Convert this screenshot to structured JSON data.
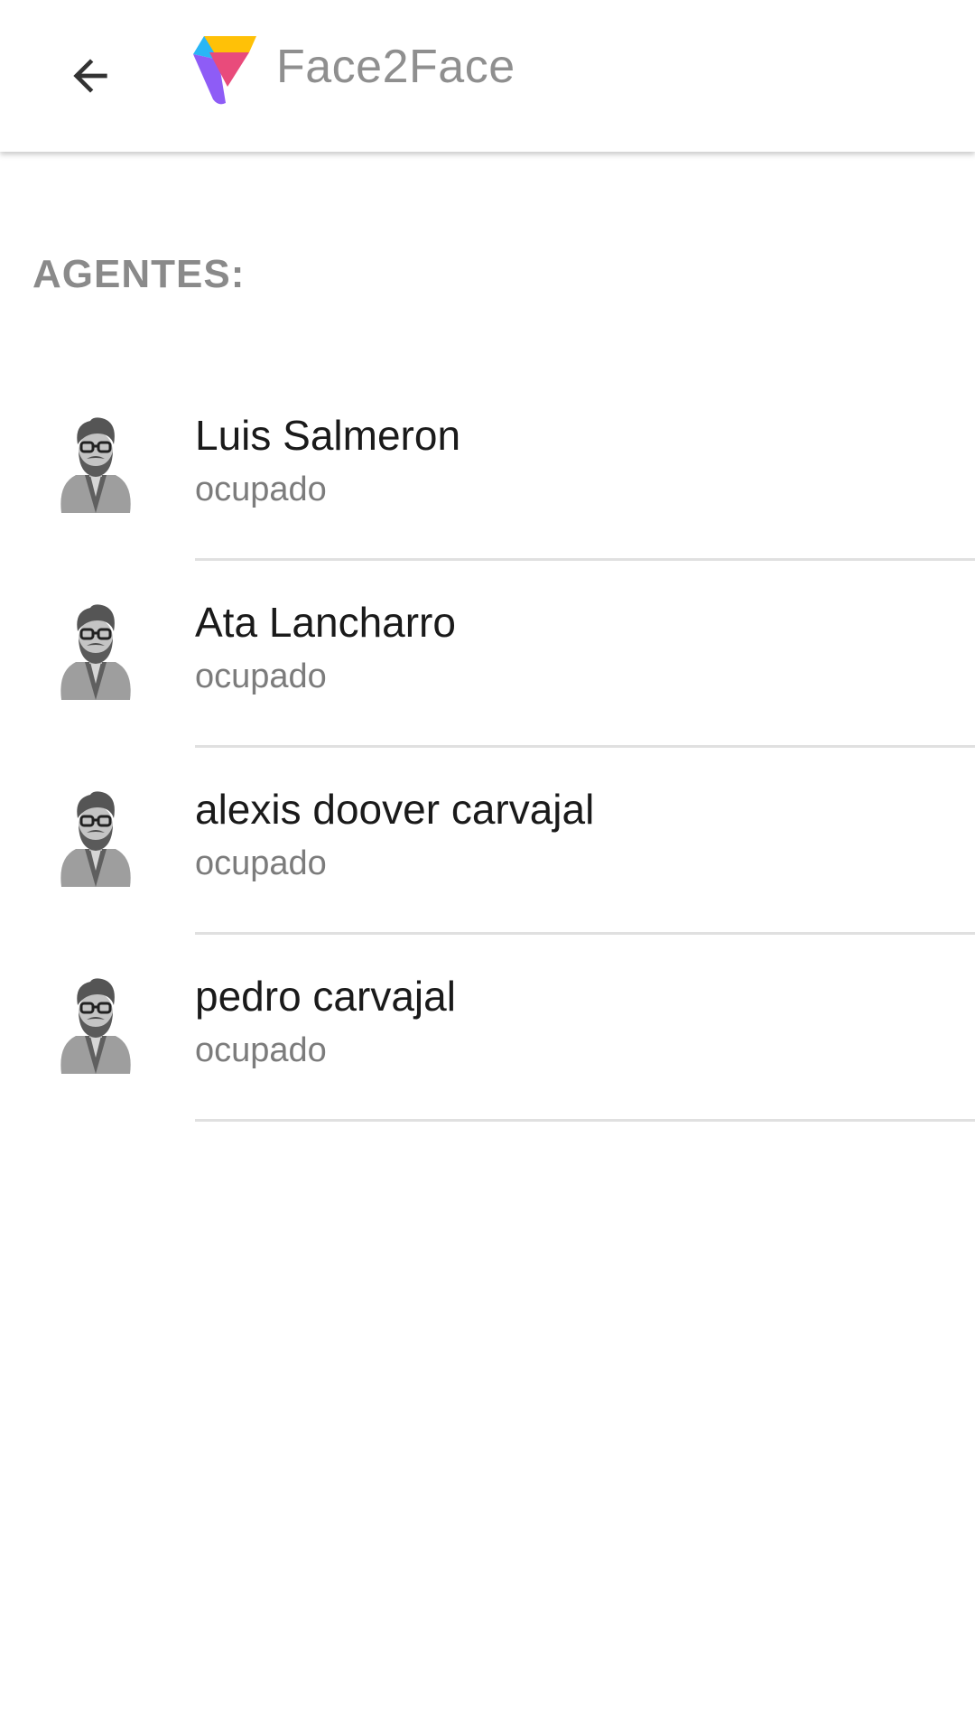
{
  "appbar": {
    "back_icon": "arrow-left-icon",
    "logo_icon": "face2face-logo-icon",
    "title": "Face2Face",
    "logo_colors": [
      "#FFC107",
      "#E94B7B",
      "#8E5CF6",
      "#29B6F6"
    ]
  },
  "section": {
    "header": "AGENTES:"
  },
  "agents": [
    {
      "name": "Luis Salmeron",
      "status": "ocupado",
      "avatar_icon": "agent-avatar-icon"
    },
    {
      "name": "Ata Lancharro",
      "status": "ocupado",
      "avatar_icon": "agent-avatar-icon"
    },
    {
      "name": "alexis doover carvajal",
      "status": "ocupado",
      "avatar_icon": "agent-avatar-icon"
    },
    {
      "name": "pedro carvajal",
      "status": "ocupado",
      "avatar_icon": "agent-avatar-icon"
    }
  ]
}
